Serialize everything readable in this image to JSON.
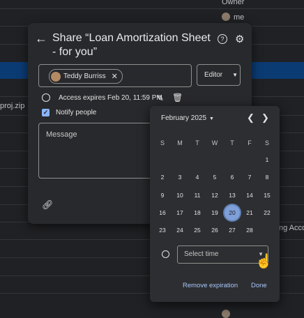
{
  "background": {
    "owner_header": "Owner",
    "owner_me": "me",
    "file_name": "proj.zip",
    "account_text": "ng Accou"
  },
  "share": {
    "title": "Share “Loan Amortization Sheet - for you”",
    "chip_name": "Teddy Burriss",
    "role": "Editor",
    "expires": "Access expires Feb 20, 11:59 PM",
    "notify": "Notify people",
    "message_placeholder": "Message"
  },
  "picker": {
    "month": "February 2025",
    "weekdays": [
      "S",
      "M",
      "T",
      "W",
      "T",
      "F",
      "S"
    ],
    "days": [
      "1",
      "2",
      "3",
      "4",
      "5",
      "6",
      "7",
      "8",
      "9",
      "10",
      "11",
      "12",
      "13",
      "14",
      "15",
      "16",
      "17",
      "18",
      "19",
      "20",
      "21",
      "22",
      "23",
      "24",
      "25",
      "26",
      "27",
      "28"
    ],
    "selected_day": "20",
    "time_placeholder": "Select time",
    "remove_label": "Remove expiration",
    "done_label": "Done"
  },
  "colors": {
    "accent": "#a8c7fa",
    "selected": "#7f9fd9",
    "dialog": "#28292c"
  }
}
